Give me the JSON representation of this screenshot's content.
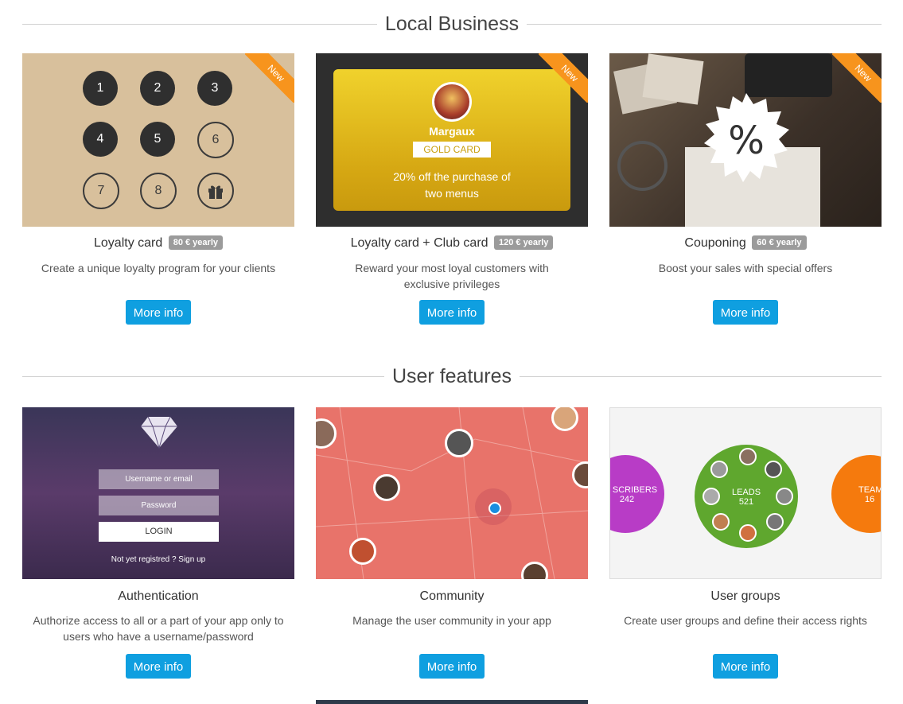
{
  "sections": [
    {
      "title": "Local Business"
    },
    {
      "title": "User features"
    }
  ],
  "cards": [
    {
      "title": "Loyalty card",
      "price": "80 € yearly",
      "desc": "Create a unique loyalty program for your clients",
      "button": "More info",
      "ribbon": "New"
    },
    {
      "title": "Loyalty card + Club card",
      "price": "120 € yearly",
      "desc": "Reward your most loyal customers with exclusive privileges",
      "button": "More info",
      "ribbon": "New"
    },
    {
      "title": "Couponing",
      "price": "60 € yearly",
      "desc": "Boost your sales with special offers",
      "button": "More info",
      "ribbon": "New"
    },
    {
      "title": "Authentication",
      "desc": "Authorize access to all or a part of your app only to users who have a username/password",
      "button": "More info"
    },
    {
      "title": "Community",
      "desc": "Manage the user community in your app",
      "button": "More info"
    },
    {
      "title": "User groups",
      "desc": "Create user groups and define their access rights",
      "button": "More info"
    }
  ],
  "loyalty_thumb": {
    "numbers": [
      "1",
      "2",
      "3",
      "4",
      "5",
      "6",
      "7",
      "8"
    ]
  },
  "gold_thumb": {
    "name": "Margaux",
    "card_label": "GOLD CARD",
    "offer_line1": "20% off the purchase of",
    "offer_line2": "two menus"
  },
  "coupon_thumb": {
    "symbol": "%"
  },
  "auth_thumb": {
    "username_placeholder": "Username or email",
    "password_placeholder": "Password",
    "login": "LOGIN",
    "signup": "Not yet registred ? Sign up"
  },
  "groups_thumb": {
    "left_label": "SCRIBERS",
    "left_count": "242",
    "center_label": "LEADS",
    "center_count": "521",
    "right_label": "TEAM",
    "right_count": "16"
  },
  "colors": {
    "accent": "#0f9fe0",
    "ribbon": "#f7941d",
    "badge": "#9b9b9b"
  }
}
